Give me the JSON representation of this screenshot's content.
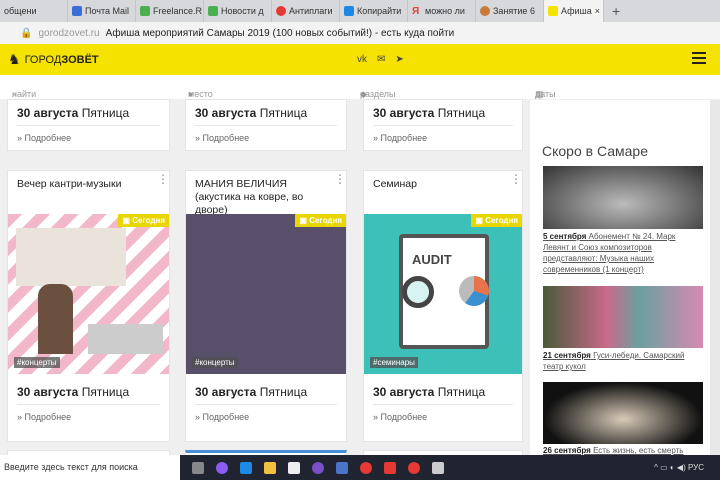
{
  "browser": {
    "tabs": [
      "общени",
      "Почта Mail",
      "Freelance.R",
      "Новости д",
      "Антиплаги",
      "Копирайти",
      "можно ли",
      "Занятие 6",
      "Афиша"
    ],
    "domain": "gorodzovet.ru",
    "page_title": "Афиша мероприятий Самары 2019 (100 новых событий!) - есть куда пойти"
  },
  "header": {
    "logo_a": "ГОРОД",
    "logo_b": "ЗОВЁТ",
    "social": [
      "vk",
      "✉",
      "➤"
    ]
  },
  "search": {
    "find": "найти",
    "place": "место",
    "sections": "разделы",
    "dates": "даты"
  },
  "cards_top": [
    {
      "date": "30 августа",
      "day": "Пятница",
      "more": "Подробнее"
    },
    {
      "date": "30 августа",
      "day": "Пятница",
      "more": "Подробнее"
    },
    {
      "date": "30 августа",
      "day": "Пятница",
      "more": "Подробнее"
    }
  ],
  "cards": [
    {
      "title": "Вечер кантри-музыки",
      "badge": "Сегодня",
      "tag": "#концерты",
      "date": "30 августа",
      "day": "Пятница",
      "more": "Подробнее"
    },
    {
      "title": "МАНИЯ ВЕЛИЧИЯ (акустика на ковре, во дворе)",
      "badge": "Сегодня",
      "tag": "#концерты",
      "date": "30 августа",
      "day": "Пятница",
      "more": "Подробнее"
    },
    {
      "title": "Семинар",
      "badge": "Сегодня",
      "tag": "#семинары",
      "date": "30 августа",
      "day": "Пятница",
      "more": "Подробнее",
      "img_text": "AUDIT"
    }
  ],
  "sidebar": {
    "title": "Скоро в Самаре",
    "items": [
      {
        "date": "5 сентября",
        "text": "Абонемент № 24. Марк Левянт и Союз композиторов представляют: Музыка наших современников (1 концерт)"
      },
      {
        "date": "21 сентября",
        "text": "Гуси-лебеди. Самарский театр кукол"
      },
      {
        "date": "26 сентября",
        "text": "Есть жизнь, есть смерть"
      }
    ]
  },
  "taskbar": {
    "search": "Введите здесь текст для поиска",
    "lang": "РУС"
  }
}
